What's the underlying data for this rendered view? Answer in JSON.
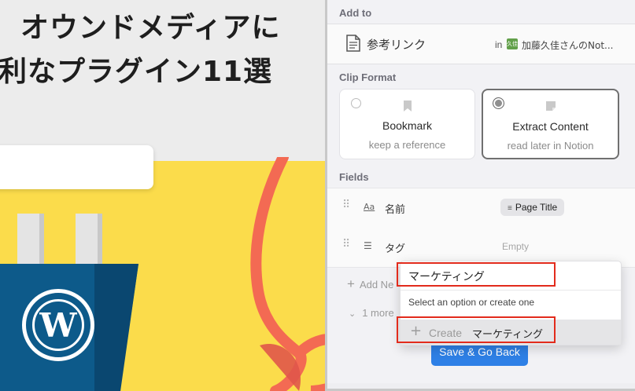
{
  "background": {
    "headline_line1": "オウンドメディアに",
    "headline_line2": "利なプラグイン11選",
    "wp_logo_letter": "W"
  },
  "panel": {
    "add_to": {
      "section_label": "Add to",
      "page_title": "参考リンク",
      "in_label": "in",
      "workspace_badge": "久佳",
      "workspace_name": "加藤久佳さんのNot..."
    },
    "clip_format": {
      "section_label": "Clip Format",
      "options": [
        {
          "title": "Bookmark",
          "subtitle": "keep a reference",
          "selected": false,
          "icon": "bookmark-icon"
        },
        {
          "title": "Extract Content",
          "subtitle": "read later in Notion",
          "selected": true,
          "icon": "note-icon"
        }
      ]
    },
    "fields": {
      "section_label": "Fields",
      "rows": [
        {
          "icon_text": "Aa",
          "name": "名前",
          "value": "Page Title",
          "icon": "text-icon"
        },
        {
          "icon_text": "☰",
          "name": "タグ",
          "value": "Empty",
          "icon": "list-icon"
        }
      ],
      "add_new_label": "Add Ne",
      "more_label": "1 more"
    },
    "dropdown": {
      "input_value": "マーケティング",
      "hint": "Select an option or create one",
      "create_label": "Create",
      "create_value": "マーケティング"
    },
    "save_button": "Save & Go Back"
  },
  "colors": {
    "accent_blue": "#2e80e6",
    "highlight_red": "#e22b1c",
    "background_yellow": "#fbdc4b",
    "cable_coral": "#f36a53",
    "wp_blue": "#0d5a8a"
  }
}
